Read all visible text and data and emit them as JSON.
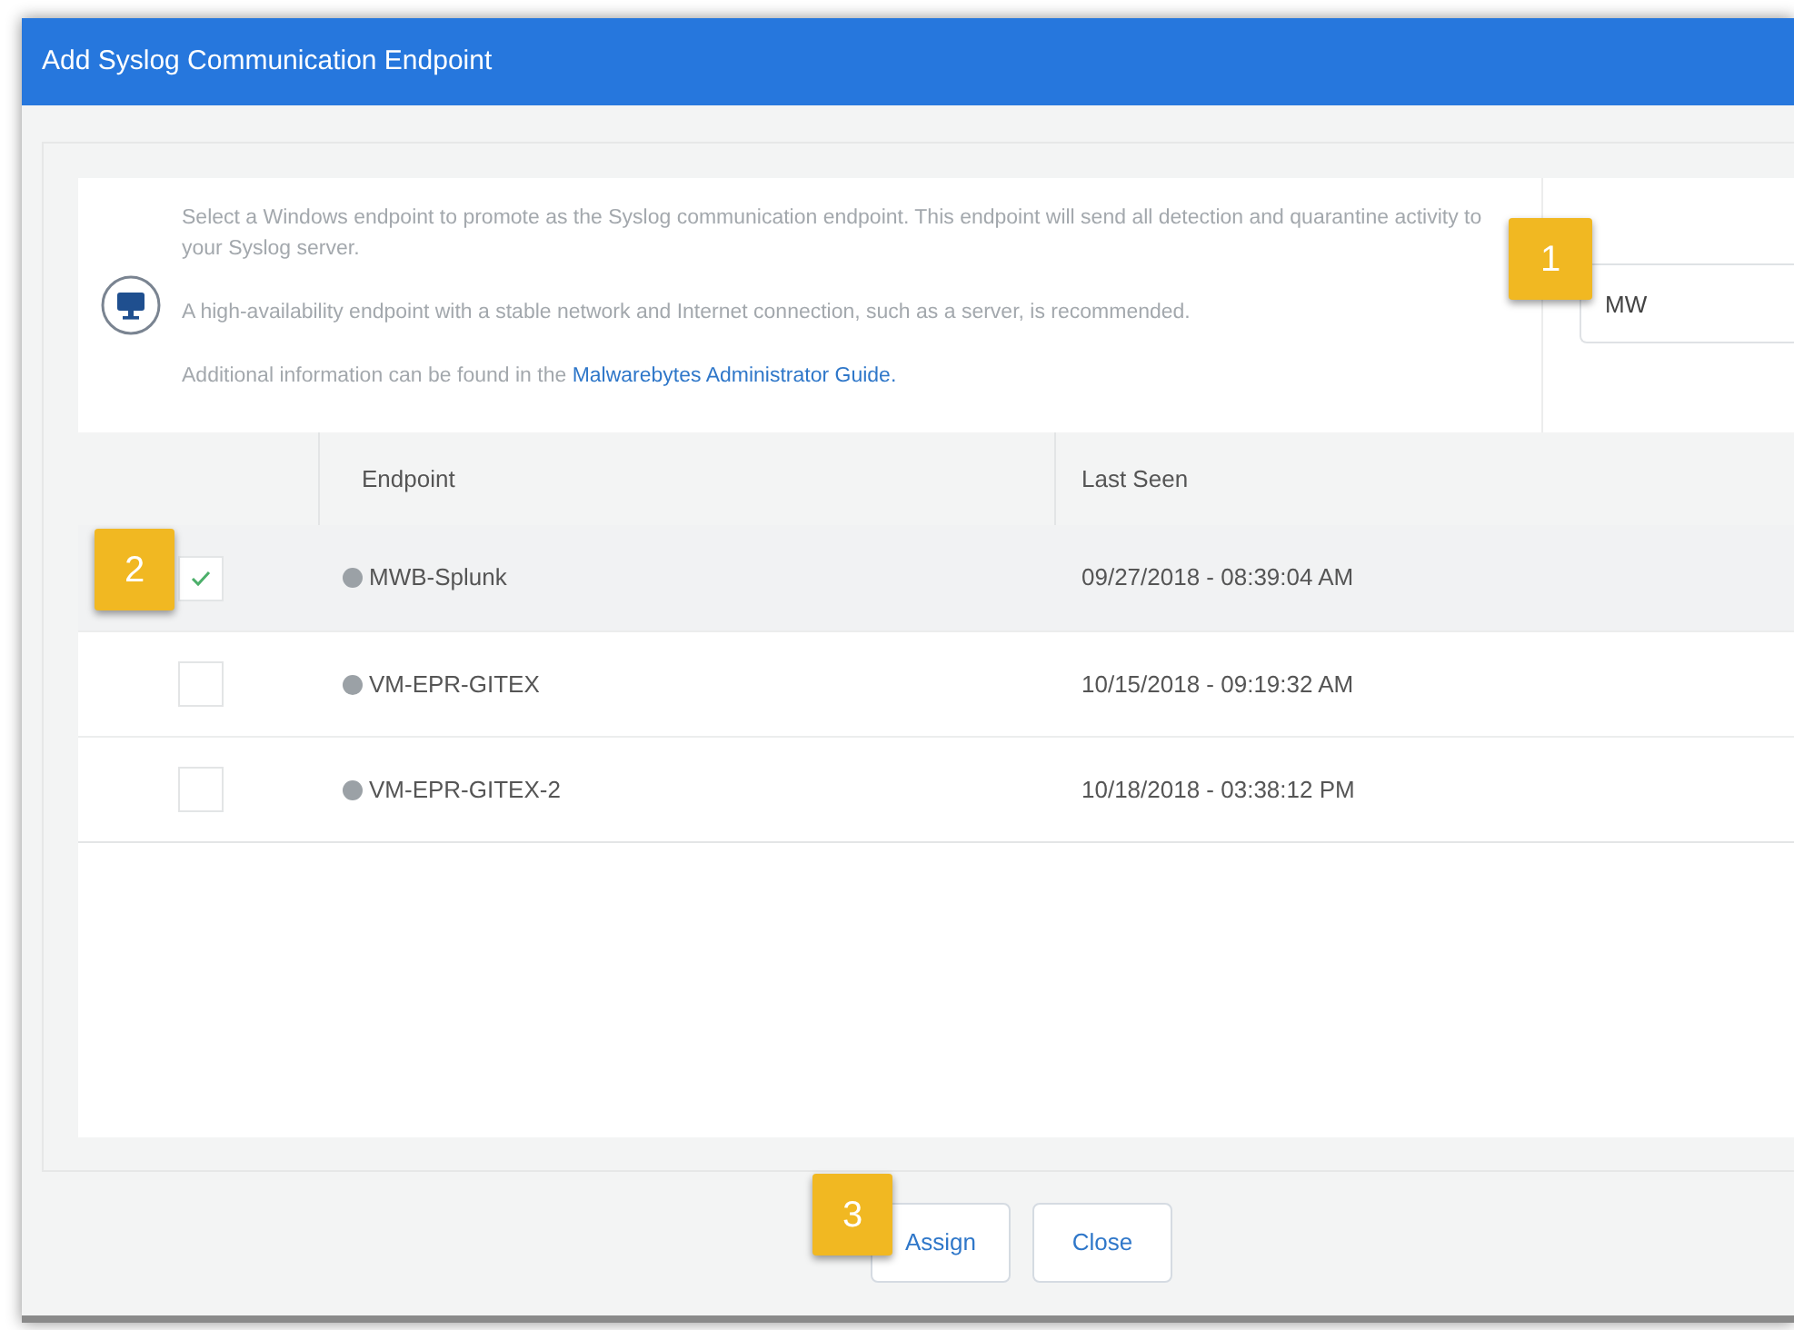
{
  "window": {
    "title": "Add Syslog Communication Endpoint"
  },
  "info": {
    "paragraphs": [
      "Select a Windows endpoint to promote as the Syslog communication endpoint. This endpoint will send all detection and quarantine activity to your Syslog server.",
      "A high-availability endpoint with a stable network and Internet connection, such as a server, is recommended."
    ],
    "guide_prefix": "Additional information can be found in the ",
    "guide_link": "Malwarebytes Administrator Guide."
  },
  "search": {
    "value": "MW"
  },
  "table": {
    "columns": [
      "Endpoint",
      "Last Seen"
    ],
    "rows": [
      {
        "checked": true,
        "selected": true,
        "endpoint": "MWB-Splunk",
        "last_seen": "09/27/2018 - 08:39:04 AM"
      },
      {
        "checked": false,
        "selected": false,
        "endpoint": "VM-EPR-GITEX",
        "last_seen": "10/15/2018 - 09:19:32 AM"
      },
      {
        "checked": false,
        "selected": false,
        "endpoint": "VM-EPR-GITEX-2",
        "last_seen": "10/18/2018 - 03:38:12 PM"
      }
    ]
  },
  "buttons": [
    "Assign",
    "Close"
  ],
  "callouts": [
    "1",
    "2",
    "3"
  ]
}
